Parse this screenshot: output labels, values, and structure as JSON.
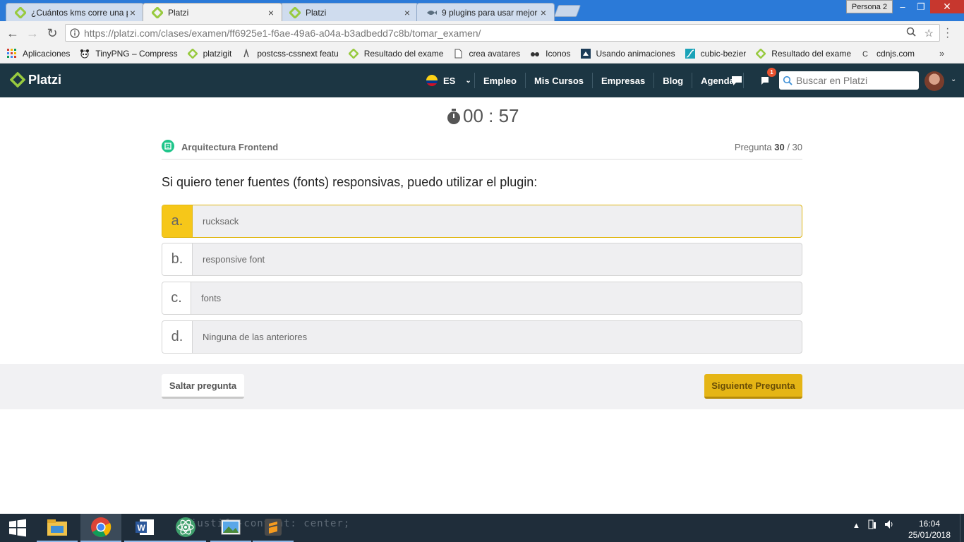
{
  "browser": {
    "tabs": [
      {
        "title": "¿Cuántos kms corre una p",
        "active": false
      },
      {
        "title": "Platzi",
        "active": true
      },
      {
        "title": "Platzi",
        "active": false
      },
      {
        "title": "9 plugins para usar mejor",
        "active": false
      }
    ],
    "close_glyph": "×",
    "persona": "Persona 2",
    "url_host": "https://platzi.com",
    "url_path": "/clases/examen/ff6925e1-f6ae-49a6-a04a-b3adbedd7c8b/tomar_examen/",
    "bookmarks": [
      {
        "label": "Aplicaciones",
        "icon": "apps-grid-icon"
      },
      {
        "label": "TinyPNG – Compress",
        "icon": "panda-icon"
      },
      {
        "label": "platzigit",
        "icon": "platzi-icon"
      },
      {
        "label": "postcss-cssnext featu",
        "icon": "postcss-icon"
      },
      {
        "label": "Resultado del exame",
        "icon": "platzi-icon"
      },
      {
        "label": "crea avatares",
        "icon": "page-icon"
      },
      {
        "label": "Iconos",
        "icon": "glasses-icon"
      },
      {
        "label": "Usando animaciones",
        "icon": "mdn-icon"
      },
      {
        "label": "cubic-bezier",
        "icon": "curve-icon"
      },
      {
        "label": "Resultado del exame",
        "icon": "platzi-icon"
      },
      {
        "label": "cdnjs.com",
        "icon": "cdnjs-icon"
      }
    ],
    "bookmarks_overflow": "»"
  },
  "site": {
    "logo_text": "Platzi",
    "lang": "ES",
    "nav": [
      "Empleo",
      "Mis Cursos",
      "Empresas",
      "Blog",
      "Agenda"
    ],
    "notif_count": "1",
    "search_placeholder": "Buscar en Platzi",
    "colors": {
      "header": "#1c3643",
      "brand_green": "#98ca3f",
      "accent_yellow": "#f6c719"
    }
  },
  "exam": {
    "timer": "00 : 57",
    "course": "Arquitectura Frontend",
    "pregunta_label": "Pregunta",
    "current": "30",
    "total": "/ 30",
    "question": "Si quiero tener fuentes (fonts) responsivas, puedo utilizar el plugin:",
    "options": [
      {
        "letter": "a.",
        "text": "rucksack",
        "selected": true
      },
      {
        "letter": "b.",
        "text": "responsive font",
        "selected": false
      },
      {
        "letter": "c.",
        "text": "fonts",
        "selected": false
      },
      {
        "letter": "d.",
        "text": "Ninguna de las anteriores",
        "selected": false
      }
    ],
    "skip_label": "Saltar pregunta",
    "next_label": "Siguiente Pregunta"
  },
  "taskbar": {
    "ghost_code": "justify-content: center;",
    "apps": [
      "file-explorer-icon",
      "chrome-icon",
      "word-icon",
      "atom-icon",
      "photos-icon",
      "sublime-icon"
    ],
    "time": "16:04",
    "date": "25/01/2018"
  }
}
